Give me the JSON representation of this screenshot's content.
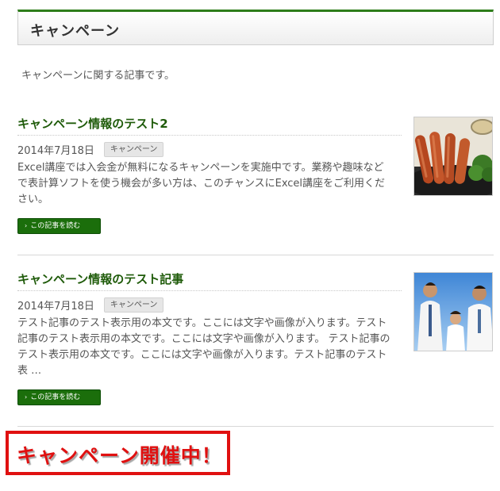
{
  "page": {
    "title": "キャンペーン"
  },
  "intro": "キャンペーンに関する記事です。",
  "posts": [
    {
      "title": "キャンペーン情報のテスト2",
      "date": "2014年7月18日",
      "category": "キャンペーン",
      "excerpt": "Excel講座では入会金が無料になるキャンペーンを実施中です。業務や趣味などで表計算ソフトを使う機会が多い方は、このチャンスにExcel講座をご利用ください。",
      "read_more": "この記事を読む",
      "thumbnail": "sausage-photo"
    },
    {
      "title": "キャンペーン情報のテスト記事",
      "date": "2014年7月18日",
      "category": "キャンペーン",
      "excerpt": "テスト記事のテスト表示用の本文です。ここには文字や画像が入ります。テスト記事のテスト表示用の本文です。ここには文字や画像が入ります。 テスト記事のテスト表示用の本文です。ここには文字や画像が入ります。テスト記事のテスト表 …",
      "read_more": "この記事を読む",
      "thumbnail": "doctors-photo"
    }
  ],
  "banner": {
    "text": "キャンペーン開催中！"
  },
  "colors": {
    "accent": "#1f5b0a",
    "button": "#1b6e0b",
    "banner_red": "#e01010"
  }
}
